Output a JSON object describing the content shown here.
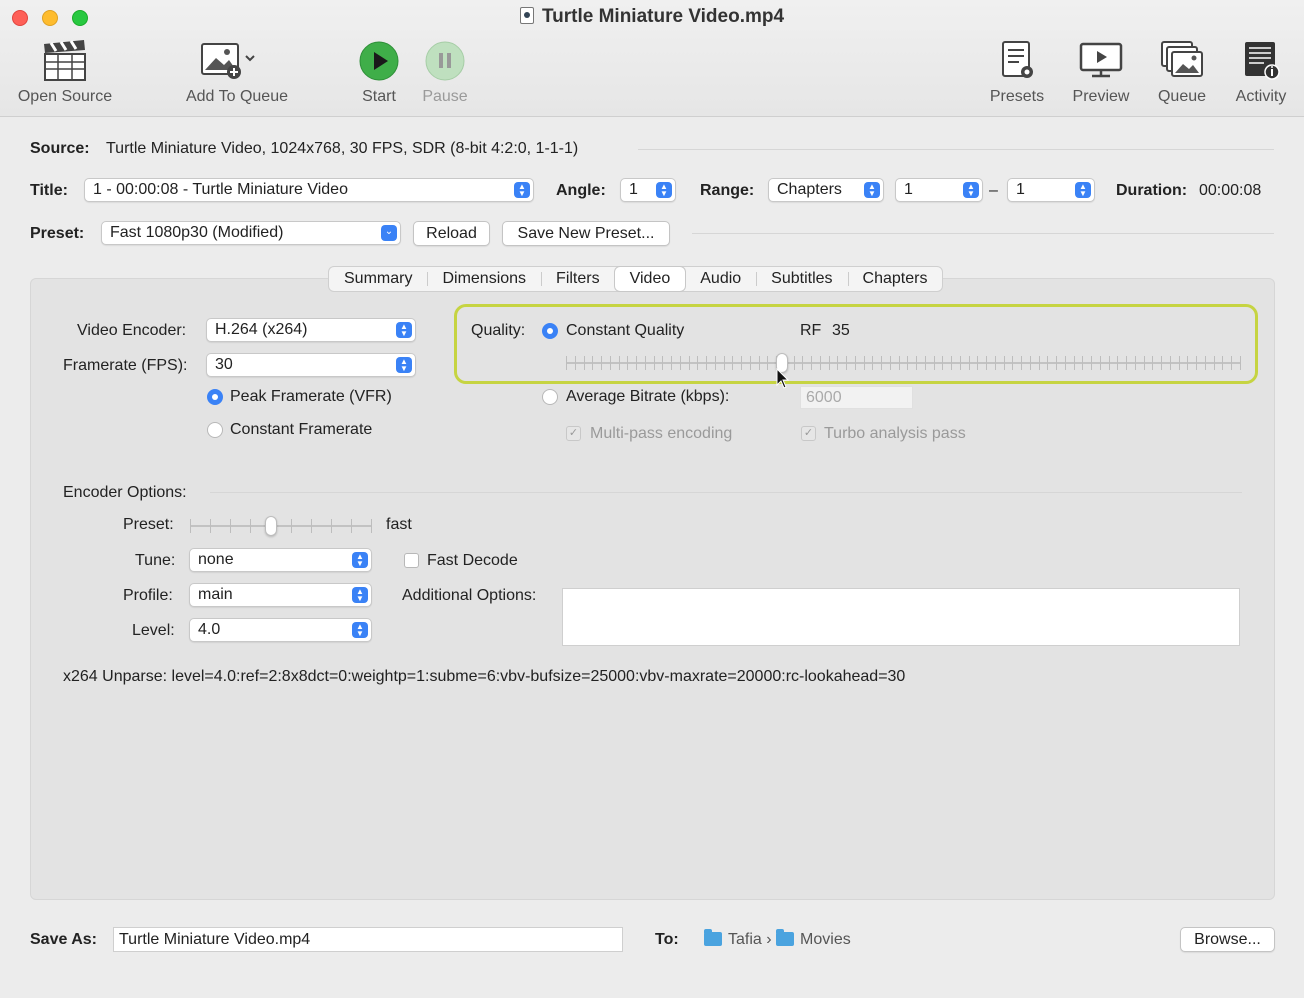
{
  "window": {
    "title": "Turtle Miniature Video.mp4"
  },
  "toolbar": {
    "open_source": "Open Source",
    "add_to_queue": "Add To Queue",
    "start": "Start",
    "pause": "Pause",
    "presets": "Presets",
    "preview": "Preview",
    "queue": "Queue",
    "activity": "Activity"
  },
  "source": {
    "label": "Source:",
    "value": "Turtle Miniature Video, 1024x768, 30 FPS, SDR (8-bit 4:2:0, 1-1-1)"
  },
  "title_row": {
    "title_label": "Title:",
    "title_value": "1 - 00:00:08 - Turtle Miniature Video",
    "angle_label": "Angle:",
    "angle_value": "1",
    "range_label": "Range:",
    "range_type": "Chapters",
    "range_start": "1",
    "range_sep": "–",
    "range_end": "1",
    "duration_label": "Duration:",
    "duration_value": "00:00:08"
  },
  "preset_row": {
    "label": "Preset:",
    "value": "Fast 1080p30 (Modified)",
    "reload": "Reload",
    "save_new": "Save New Preset..."
  },
  "tabs": [
    "Summary",
    "Dimensions",
    "Filters",
    "Video",
    "Audio",
    "Subtitles",
    "Chapters"
  ],
  "active_tab": "Video",
  "video": {
    "encoder_label": "Video Encoder:",
    "encoder_value": "H.264 (x264)",
    "framerate_label": "Framerate (FPS):",
    "framerate_value": "30",
    "peak_framerate": "Peak Framerate (VFR)",
    "constant_framerate": "Constant Framerate",
    "quality_label": "Quality:",
    "constant_quality": "Constant Quality",
    "rf_label": "RF",
    "rf_value": "35",
    "rf_slider_fraction": 0.32,
    "average_bitrate": "Average Bitrate (kbps):",
    "bitrate_value": "6000",
    "multipass": "Multi-pass encoding",
    "turbo": "Turbo analysis pass"
  },
  "encoder_options": {
    "heading": "Encoder Options:",
    "preset_label": "Preset:",
    "preset_value": "fast",
    "preset_slider_fraction": 0.444,
    "tune_label": "Tune:",
    "tune_value": "none",
    "fast_decode": "Fast Decode",
    "profile_label": "Profile:",
    "profile_value": "main",
    "additional_label": "Additional Options:",
    "level_label": "Level:",
    "level_value": "4.0",
    "unparse": "x264 Unparse: level=4.0:ref=2:8x8dct=0:weightp=1:subme=6:vbv-bufsize=25000:vbv-maxrate=20000:rc-lookahead=30"
  },
  "footer": {
    "save_as_label": "Save As:",
    "save_as_value": "Turtle Miniature Video.mp4",
    "to_label": "To:",
    "path_user": "Tafia",
    "path_sep": "›",
    "path_folder": "Movies",
    "browse": "Browse..."
  },
  "colors": {
    "accent": "#3a82f6",
    "highlight": "#c6d442",
    "start_green": "#3fae49"
  }
}
